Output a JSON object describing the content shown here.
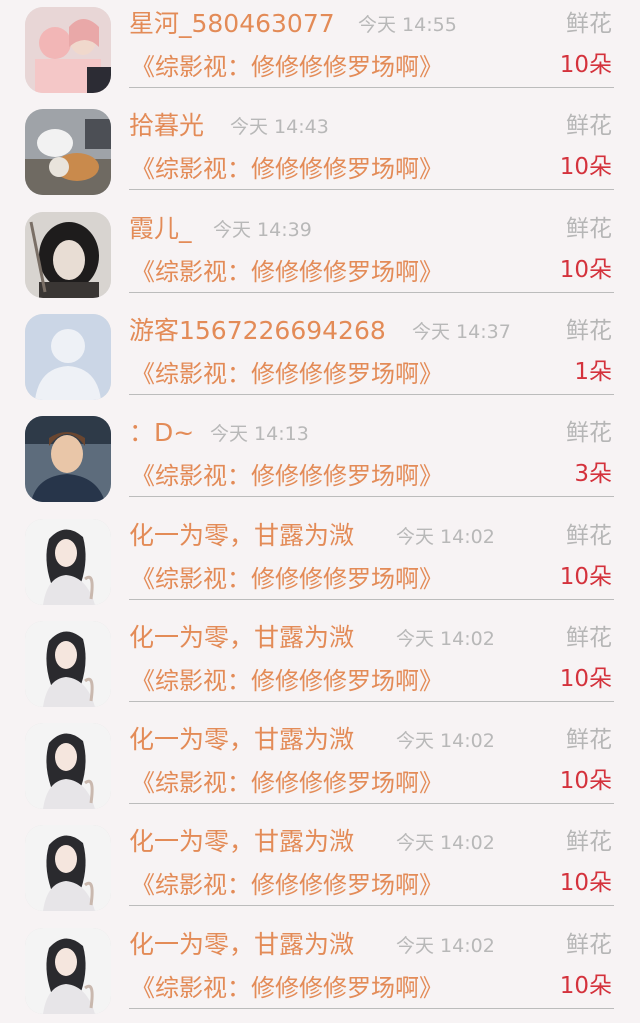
{
  "rows": [
    {
      "name": "星河_580463077",
      "time": "今天 14:55",
      "gift": "鲜花",
      "book": "《综影视：修修修修罗场啊》",
      "count": "10朵",
      "avatar": "anime-girl-avatar-icon"
    },
    {
      "name": "拾暮光",
      "time": "今天 14:43",
      "gift": "鲜花",
      "book": "《综影视：修修修修罗场啊》",
      "count": "10朵",
      "avatar": "dogs-photo-avatar-icon"
    },
    {
      "name": "霞儿_",
      "time": "今天 14:39",
      "gift": "鲜花",
      "book": "《综影视：修修修修罗场啊》",
      "count": "10朵",
      "avatar": "dark-hair-portrait-avatar-icon"
    },
    {
      "name": "游客1567226694268",
      "time": "今天 14:37",
      "gift": "鲜花",
      "book": "《综影视：修修修修罗场啊》",
      "count": "1朵",
      "avatar": "default-user-avatar-icon"
    },
    {
      "name": "：D~",
      "time": "今天 14:13",
      "gift": "鲜花",
      "book": "《综影视：修修修修罗场啊》",
      "count": "3朵",
      "avatar": "smiling-person-photo-avatar-icon"
    },
    {
      "name": "化一为零，甘露为溦",
      "time": "今天 14:02",
      "gift": "鲜花",
      "book": "《综影视：修修修修罗场啊》",
      "count": "10朵",
      "avatar": "ancient-style-woman-avatar-icon"
    },
    {
      "name": "化一为零，甘露为溦",
      "time": "今天 14:02",
      "gift": "鲜花",
      "book": "《综影视：修修修修罗场啊》",
      "count": "10朵",
      "avatar": "ancient-style-woman-avatar-icon"
    },
    {
      "name": "化一为零，甘露为溦",
      "time": "今天 14:02",
      "gift": "鲜花",
      "book": "《综影视：修修修修罗场啊》",
      "count": "10朵",
      "avatar": "ancient-style-woman-avatar-icon"
    },
    {
      "name": "化一为零，甘露为溦",
      "time": "今天 14:02",
      "gift": "鲜花",
      "book": "《综影视：修修修修罗场啊》",
      "count": "10朵",
      "avatar": "ancient-style-woman-avatar-icon"
    },
    {
      "name": "化一为零，甘露为溦",
      "time": "今天 14:02",
      "gift": "鲜花",
      "book": "《综影视：修修修修罗场啊》",
      "count": "10朵",
      "avatar": "ancient-style-woman-avatar-icon"
    }
  ],
  "colors": {
    "background": "#f7f3f4",
    "name_orange": "#e38b57",
    "time_gray": "#b8b8b8",
    "count_red": "#d4323c"
  }
}
